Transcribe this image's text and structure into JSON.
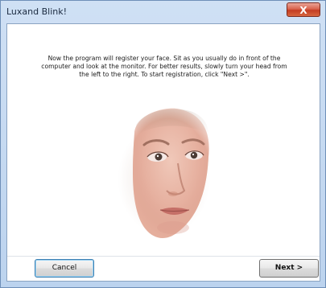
{
  "window": {
    "title": "Luxand Blink!",
    "close_label": "X"
  },
  "content": {
    "instructions": "Now the program will register your face. Sit as you usually do in front of the computer and look at the monitor. For better results, slowly turn your head from the left to the right. To start registration, click \"Next >\"."
  },
  "buttons": {
    "cancel_label": "Cancel",
    "next_label": "Next >"
  },
  "colors": {
    "titlebar": "#c9dcf2",
    "close_button": "#c43d22",
    "focus_border": "#3c7fb1"
  }
}
